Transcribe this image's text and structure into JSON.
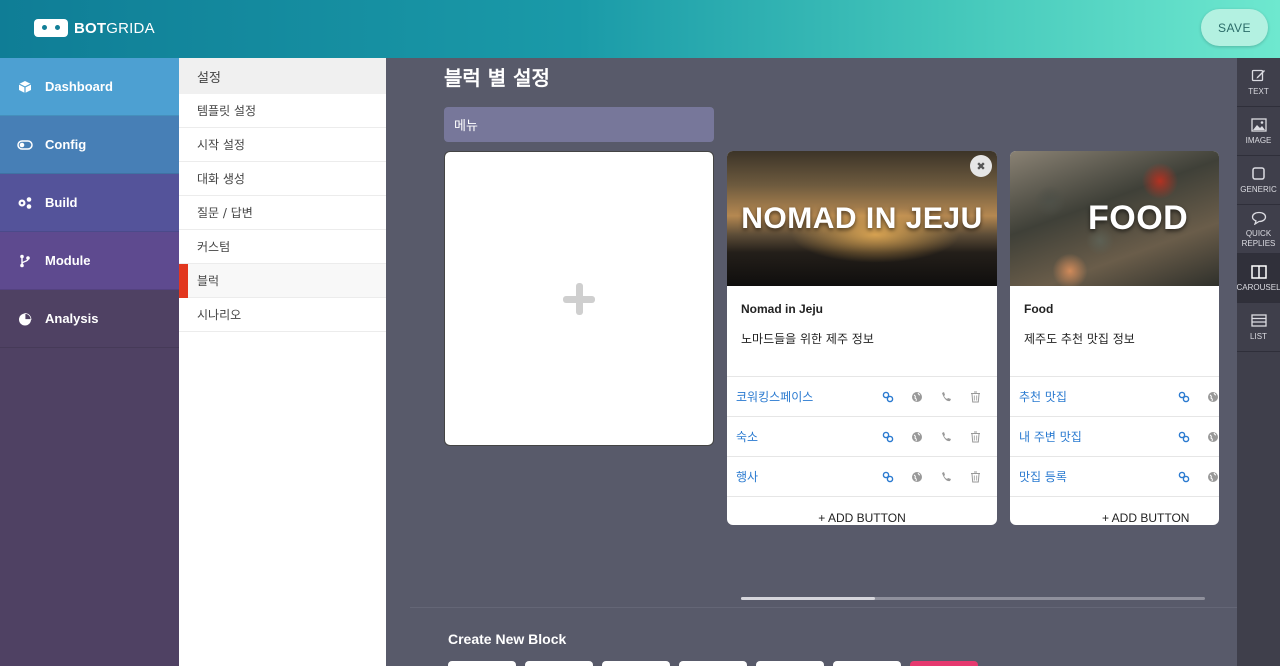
{
  "app": {
    "logo_bold": "BOT",
    "logo_thin": "GRIDA",
    "save_label": "SAVE"
  },
  "nav": [
    {
      "label": "Dashboard",
      "icon": "cube-icon"
    },
    {
      "label": "Config",
      "icon": "toggle-icon"
    },
    {
      "label": "Build",
      "icon": "gears-icon"
    },
    {
      "label": "Module",
      "icon": "branch-icon"
    },
    {
      "label": "Analysis",
      "icon": "pie-chart-icon"
    }
  ],
  "submenu": {
    "header": "설정",
    "items": [
      "템플릿 설정",
      "시작 설정",
      "대화 생성",
      "질문 / 답변",
      "커스텀",
      "블럭",
      "시나리오"
    ],
    "active_index": 5
  },
  "main": {
    "title": "블럭 별 설정",
    "block_name": "메뉴",
    "cards": [
      {
        "image_text": "NOMAD IN JEJU",
        "title": "Nomad in Jeju",
        "description": "노마드들을 위한 제주 정보",
        "buttons": [
          "코워킹스페이스",
          "숙소",
          "행사"
        ],
        "add_button": "+ ADD BUTTON"
      },
      {
        "image_text": "FOOD",
        "title": "Food",
        "description": "제주도 추천 맛집 정보",
        "buttons": [
          "추천 맛집",
          "내 주변 맛집",
          "맛집 등록"
        ],
        "add_button": "+ ADD BUTTON"
      }
    ],
    "create_new_block": "Create New Block"
  },
  "tools": [
    {
      "label": "TEXT",
      "icon": "edit-icon"
    },
    {
      "label": "IMAGE",
      "icon": "image-icon"
    },
    {
      "label": "GENERIC",
      "icon": "square-icon"
    },
    {
      "label": "QUICK REPLIES",
      "icon": "speech-bubble-icon"
    },
    {
      "label": "CAROUSEL",
      "icon": "carousel-icon"
    },
    {
      "label": "LIST",
      "icon": "list-icon"
    }
  ],
  "colors": {
    "accent_red": "#e2371f",
    "link_blue": "#2a7ad0",
    "save_bg": "#b3f1e1"
  }
}
